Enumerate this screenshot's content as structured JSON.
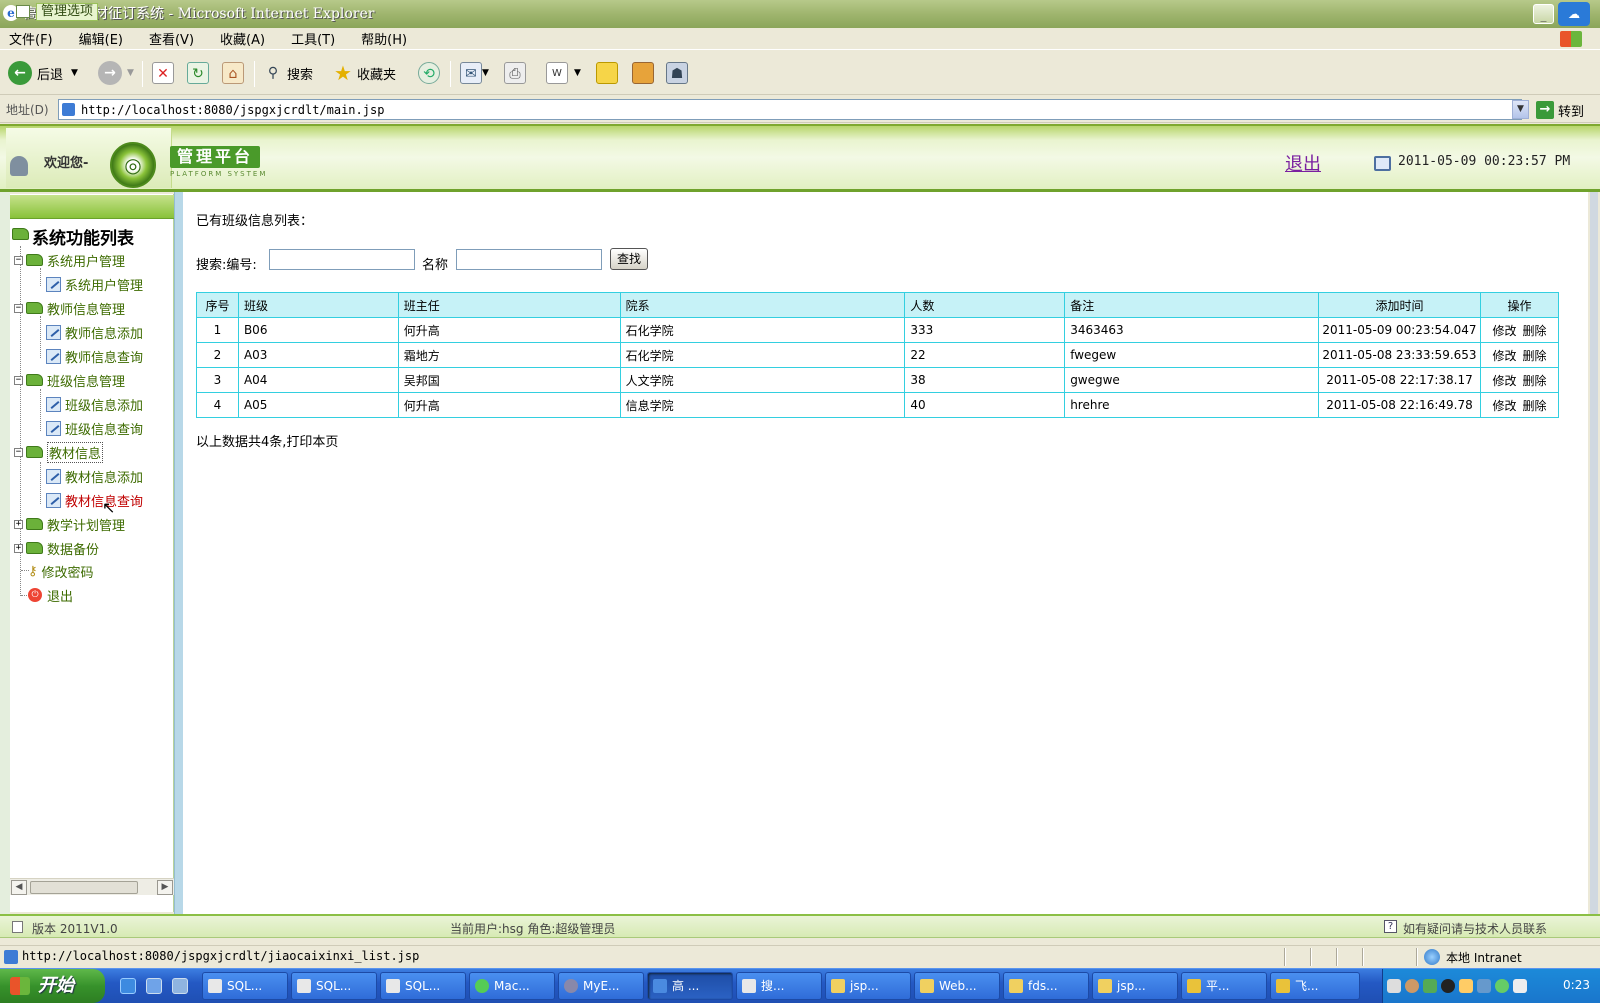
{
  "window": {
    "title": "高校网上教材征订系统 - Microsoft Internet Explorer"
  },
  "menu": [
    "文件(F)",
    "编辑(E)",
    "查看(V)",
    "收藏(A)",
    "工具(T)",
    "帮助(H)"
  ],
  "toolbar": {
    "back": "后退",
    "search": "搜索",
    "favorites": "收藏夹"
  },
  "address": {
    "label": "地址(D)",
    "url": "http://localhost:8080/jspgxjcrdlt/main.jsp",
    "go": "转到"
  },
  "header": {
    "welcome": "欢迎您-",
    "logo_title": "管理平台",
    "logo_subtitle": "PLATFORM SYSTEM",
    "logout": "退出",
    "datetime": "2011-05-09 00:23:57 PM"
  },
  "sidebar": {
    "head_label": "管理选项",
    "tree_title": "系统功能列表",
    "groups": [
      {
        "label": "系统用户管理",
        "items": [
          "系统用户管理"
        ]
      },
      {
        "label": "教师信息管理",
        "items": [
          "教师信息添加",
          "教师信息查询"
        ]
      },
      {
        "label": "班级信息管理",
        "items": [
          "班级信息添加",
          "班级信息查询"
        ]
      },
      {
        "label": "教材信息",
        "items": [
          "教材信息添加",
          "教材信息查询"
        ]
      },
      {
        "label": "教学计划管理",
        "items": []
      },
      {
        "label": "数据备份",
        "items": []
      }
    ],
    "change_password": "修改密码",
    "exit": "退出"
  },
  "main": {
    "list_title": "已有班级信息列表：",
    "search_label": "搜索:编号:",
    "search_id_value": "",
    "name_label": "名称",
    "search_name_value": "",
    "find_button": "查找",
    "columns": [
      "序号",
      "班级",
      "班主任",
      "院系",
      "人数",
      "备注",
      "添加时间",
      "操作"
    ],
    "rows": [
      {
        "no": "1",
        "class": "B06",
        "teacher": "何升高",
        "dept": "石化学院",
        "count": "333",
        "note": "3463463",
        "time": "2011-05-09 00:23:54.047"
      },
      {
        "no": "2",
        "class": "A03",
        "teacher": "霜地方",
        "dept": "石化学院",
        "count": "22",
        "note": "fwegew",
        "time": "2011-05-08 23:33:59.653"
      },
      {
        "no": "3",
        "class": "A04",
        "teacher": "吴邦国",
        "dept": "人文学院",
        "count": "38",
        "note": "gwegwe",
        "time": "2011-05-08 22:17:38.17"
      },
      {
        "no": "4",
        "class": "A05",
        "teacher": "何升高",
        "dept": "信息学院",
        "count": "40",
        "note": "hrehre",
        "time": "2011-05-08 22:16:49.78"
      }
    ],
    "edit_label": "修改",
    "delete_label": "删除",
    "summary_prefix": "以上数据共4条,",
    "print_label": "打印本页"
  },
  "footer": {
    "version": "版本 2011V1.0",
    "current_user": "当前用户:hsg  角色:超级管理员",
    "help": "如有疑问请与技术人员联系"
  },
  "status": {
    "url": "http://localhost:8080/jspgxjcrdlt/jiaocaixinxi_list.jsp",
    "zone": "本地 Intranet"
  },
  "taskbar": {
    "start": "开始",
    "tasks": [
      "SQL...",
      "SQL...",
      "SQL...",
      "Mac...",
      "MyE...",
      "高 ...",
      "搜...",
      "jsp...",
      "Web...",
      "fds...",
      "jsp...",
      "平...",
      "飞..."
    ],
    "clock": "0:23"
  },
  "colors": {
    "accent_green": "#6fa22c",
    "table_border": "#33cfe0",
    "table_header": "#c6f2f7",
    "taskbar_blue": "#2459c4"
  }
}
